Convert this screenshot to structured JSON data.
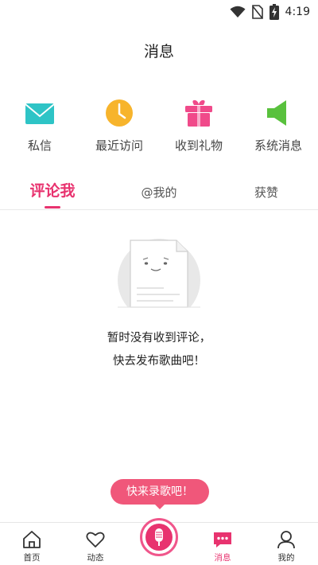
{
  "status_bar": {
    "time": "4:19"
  },
  "header": {
    "title": "消息"
  },
  "quick_actions": [
    {
      "label": "私信",
      "icon": "mail-icon",
      "color": "#2ec4c6"
    },
    {
      "label": "最近访问",
      "icon": "clock-icon",
      "color": "#f7b42c"
    },
    {
      "label": "收到礼物",
      "icon": "gift-icon",
      "color": "#f04a8a"
    },
    {
      "label": "系统消息",
      "icon": "speaker-icon",
      "color": "#59c13d"
    }
  ],
  "tabs": [
    {
      "label": "评论我",
      "active": true
    },
    {
      "label": "@我的",
      "active": false
    },
    {
      "label": "获赞",
      "active": false
    }
  ],
  "empty_state": {
    "line1": "暂时没有收到评论，",
    "line2": "快去发布歌曲吧！"
  },
  "record_bubble": {
    "label": "快来录歌吧！"
  },
  "bottom_nav": [
    {
      "label": "首页",
      "icon": "home-icon",
      "active": false
    },
    {
      "label": "动态",
      "icon": "heart-icon",
      "active": false
    },
    {
      "label": "",
      "icon": "microphone-icon",
      "active": false
    },
    {
      "label": "消息",
      "icon": "chat-icon",
      "active": true
    },
    {
      "label": "我的",
      "icon": "user-icon",
      "active": false
    }
  ],
  "colors": {
    "accent": "#e8336f",
    "bubble": "#f0577a"
  }
}
